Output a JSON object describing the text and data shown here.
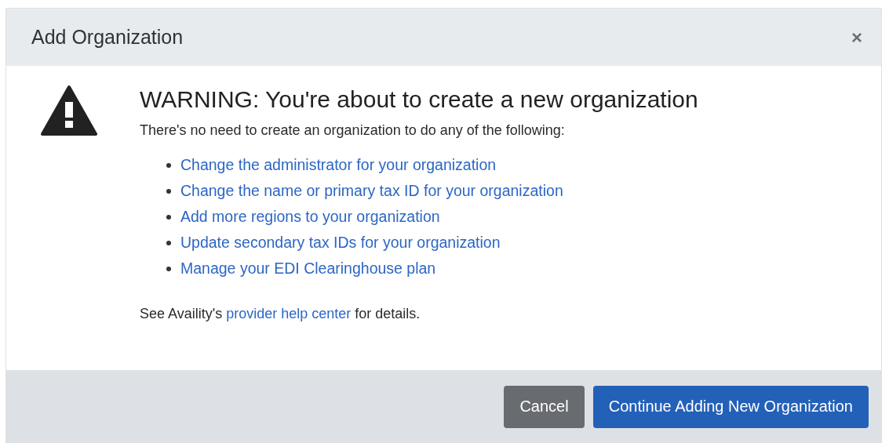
{
  "dialog": {
    "title": "Add Organization",
    "close": "×"
  },
  "warning": {
    "heading": "WARNING: You're about to create a new organization",
    "intro": "There's no need to create an organization to do any of the following:",
    "links": [
      "Change the administrator for your organization",
      "Change the name or primary tax ID for your organization",
      "Add more regions to your organization",
      "Update secondary tax IDs for your organization",
      "Manage your EDI Clearinghouse plan"
    ],
    "note": {
      "before": "See Availity's",
      "link": "provider help center",
      "after": "for details."
    }
  },
  "buttons": [
    {
      "label": "Cancel",
      "kind": "secondary"
    },
    {
      "label": "Continue Adding New Organization",
      "kind": "primary"
    }
  ]
}
